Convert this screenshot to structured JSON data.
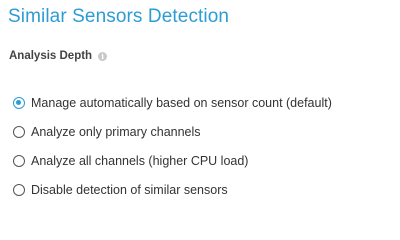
{
  "section": {
    "title": "Similar Sensors Detection"
  },
  "analysis_depth": {
    "label": "Analysis Depth",
    "info_icon": "info-icon",
    "selected_index": 0,
    "options": [
      {
        "label": "Manage automatically based on sensor count (default)",
        "checked": true
      },
      {
        "label": "Analyze only primary channels",
        "checked": false
      },
      {
        "label": "Analyze all channels (higher CPU load)",
        "checked": false
      },
      {
        "label": "Disable detection of similar sensors",
        "checked": false
      }
    ]
  },
  "colors": {
    "accent": "#2d9cd3",
    "text": "#333333"
  }
}
